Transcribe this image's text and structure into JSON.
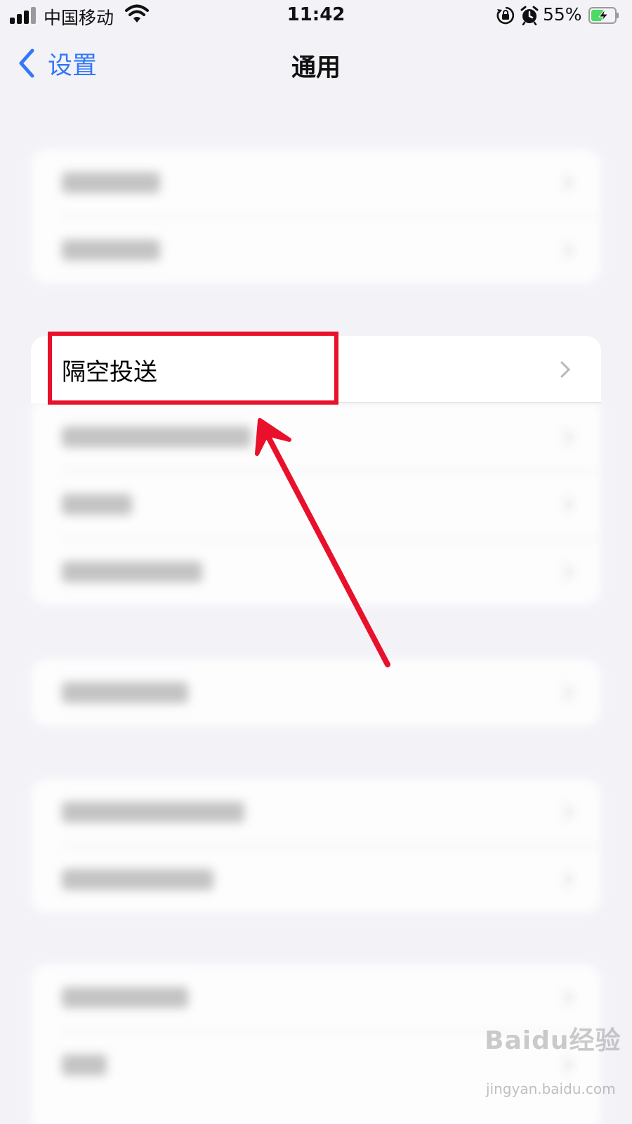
{
  "status_bar": {
    "carrier": "中国移动",
    "time": "11:42",
    "battery_percent": "55%",
    "battery_level": 0.55,
    "icons": [
      "signal-icon",
      "wifi-icon",
      "orientation-lock-icon",
      "alarm-icon",
      "battery-charging-icon"
    ]
  },
  "nav": {
    "back_label": "设置",
    "title": "通用"
  },
  "list": {
    "airdrop_label": "隔空投送"
  },
  "colors": {
    "accent": "#3478f6",
    "background": "#f2f2f7",
    "annotation_red": "#e8102a"
  },
  "watermark": {
    "brand": "Baidu经验",
    "url": "jingyan.baidu.com"
  }
}
